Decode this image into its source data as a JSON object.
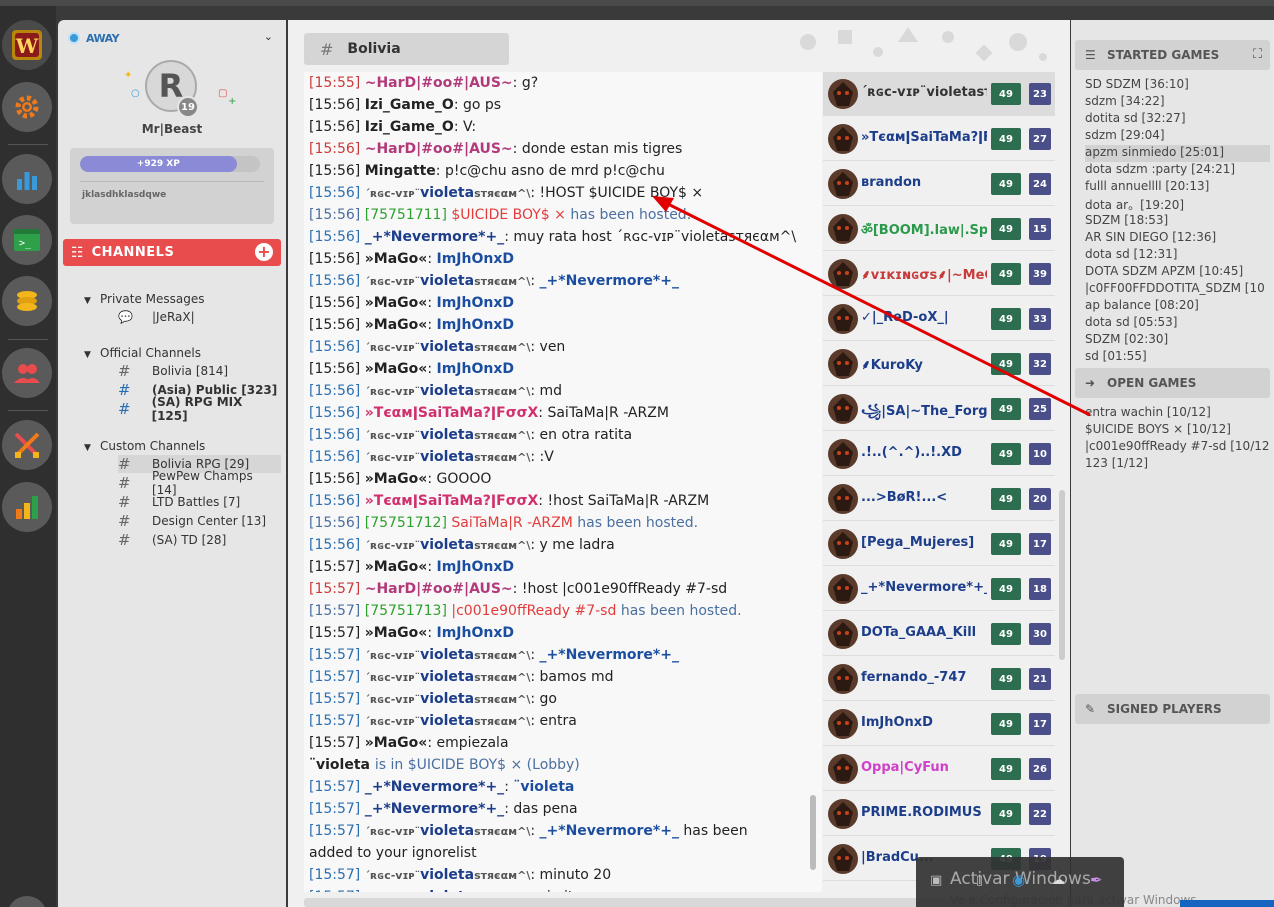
{
  "status": {
    "label": "AWAY"
  },
  "profile": {
    "name": "Mr|Beast",
    "level": "19",
    "xp_label": "+929 XP",
    "xp_fraction": 0.87,
    "motto": "jklasdhklasdqwe"
  },
  "channels": {
    "header": "CHANNELS",
    "groups": [
      {
        "title": "Private Messages",
        "items": [
          {
            "name": "|JeRaX|"
          }
        ]
      },
      {
        "title": "Official Channels",
        "items": [
          {
            "name": "Bolivia [814]"
          },
          {
            "name": "(Asia) Public [323]"
          },
          {
            "name": "(SA) RPG MIX [125]"
          }
        ]
      },
      {
        "title": "Custom Channels",
        "items": [
          {
            "name": "Bolivia RPG [29]"
          },
          {
            "name": "PewPew Champs [14]"
          },
          {
            "name": "LTD Battles [7]"
          },
          {
            "name": "Design Center [13]"
          },
          {
            "name": "(SA) TD [28]"
          }
        ]
      }
    ]
  },
  "tab": {
    "name": "Bolivia"
  },
  "messages": [
    {
      "ts": "[15:55]",
      "name": "~HarD|#oo#|AUS~",
      "text": "g?"
    },
    {
      "ts": "[15:56]",
      "name": "Izi_Game_O",
      "text": "go ps"
    },
    {
      "ts": "[15:56]",
      "name": "Izi_Game_O",
      "text": "V:"
    },
    {
      "ts": "[15:56]",
      "name": "~HarD|#oo#|AUS~",
      "text": "donde estan mis tigres"
    },
    {
      "ts": "[15:56]",
      "name": "Mingatte",
      "text": "p!c@chu asno de mrd p!c@chu"
    },
    {
      "ts": "[15:56]",
      "name": "´ʀɢᴄ-ᴠɪᴘ¨violetaѕтяєαм^\\",
      "text": "!HOST $UICIDE BOY$ ×"
    },
    {
      "ts": "[15:56]",
      "id": "[75751711]",
      "game": "$UICIDE BOY$ ×",
      "text": "has been hosted."
    },
    {
      "ts": "[15:56]",
      "name": "_+*Nevermore*+_",
      "text": "muy rata host ´ʀɢᴄ-ᴠɪᴘ¨violetaѕтяєαм^\\"
    },
    {
      "ts": "[15:56]",
      "name": "»MaGo«",
      "text": "ImJhOnxD"
    },
    {
      "ts": "[15:56]",
      "name": "´ʀɢᴄ-ᴠɪᴘ¨violetaѕтяєαм^\\",
      "text": "_+*Nevermore*+_"
    },
    {
      "ts": "[15:56]",
      "name": "»MaGo«",
      "text": "ImJhOnxD"
    },
    {
      "ts": "[15:56]",
      "name": "»MaGo«",
      "text": "ImJhOnxD"
    },
    {
      "ts": "[15:56]",
      "name": "´ʀɢᴄ-ᴠɪᴘ¨violetaѕтяєαм^\\",
      "text": "ven"
    },
    {
      "ts": "[15:56]",
      "name": "»MaGo«",
      "text": "ImJhOnxD"
    },
    {
      "ts": "[15:56]",
      "name": "´ʀɢᴄ-ᴠɪᴘ¨violetaѕтяєαм^\\",
      "text": "md"
    },
    {
      "ts": "[15:56]",
      "name": "»TєαмǀSaiTaMa?ǀFσσX",
      "text": "SaiTaMa|R -ARZM"
    },
    {
      "ts": "[15:56]",
      "name": "´ʀɢᴄ-ᴠɪᴘ¨violetaѕтяєαм^\\",
      "text": "en otra ratita"
    },
    {
      "ts": "[15:56]",
      "name": "´ʀɢᴄ-ᴠɪᴘ¨violetaѕтяєαм^\\",
      "text": ":V"
    },
    {
      "ts": "[15:56]",
      "name": "»MaGo«",
      "text": "GOOOO"
    },
    {
      "ts": "[15:56]",
      "name": "»TєαмǀSaiTaMa?ǀFσσX",
      "text": "!host SaiTaMa|R -ARZM"
    },
    {
      "ts": "[15:56]",
      "id": "[75751712]",
      "game": "SaiTaMa|R -ARZM",
      "text": "has been hosted."
    },
    {
      "ts": "[15:56]",
      "name": "´ʀɢᴄ-ᴠɪᴘ¨violetaѕтяєαм^\\",
      "text": "y me ladra"
    },
    {
      "ts": "[15:57]",
      "name": "»MaGo«",
      "text": "ImJhOnxD"
    },
    {
      "ts": "[15:57]",
      "name": "~HarD|#oo#|AUS~",
      "text": "!host |c001e90ffReady #7-sd"
    },
    {
      "ts": "[15:57]",
      "id": "[75751713]",
      "game": "|c001e90ffReady #7-sd",
      "text": "has been hosted."
    },
    {
      "ts": "[15:57]",
      "name": "»MaGo«",
      "text": "ImJhOnxD"
    },
    {
      "ts": "[15:57]",
      "name": "´ʀɢᴄ-ᴠɪᴘ¨violetaѕтяєαм^\\",
      "text": "_+*Nevermore*+_"
    },
    {
      "ts": "[15:57]",
      "name": "´ʀɢᴄ-ᴠɪᴘ¨violetaѕтяєαм^\\",
      "text": "bamos md"
    },
    {
      "ts": "[15:57]",
      "name": "´ʀɢᴄ-ᴠɪᴘ¨violetaѕтяєαм^\\",
      "text": "go"
    },
    {
      "ts": "[15:57]",
      "name": "´ʀɢᴄ-ᴠɪᴘ¨violetaѕтяєαм^\\",
      "text": "entra"
    },
    {
      "ts": "[15:57]",
      "name": "»MaGo«",
      "text": "empiezala"
    },
    {
      "lobby_name": "¨violeta",
      "text": "is in $UICIDE BOY$ × (Lobby)"
    },
    {
      "ts": "[15:57]",
      "name": "_+*Nevermore*+_",
      "text": "¨violeta"
    },
    {
      "ts": "[15:57]",
      "name": "_+*Nevermore*+_",
      "text": "das pena"
    },
    {
      "ts": "[15:57]",
      "name": "´ʀɢᴄ-ᴠɪᴘ¨violetaѕтяєαм^\\",
      "text": "_+*Nevermore*+_",
      "suffix": "has been"
    },
    {
      "cont": "added to your ignorelist"
    },
    {
      "ts": "[15:57]",
      "name": "´ʀɢᴄ-ᴠɪᴘ¨violetaѕтяєαм^\\",
      "text": "minuto 20"
    },
    {
      "ts": "[15:57]",
      "name": "´ʀɢᴄ-ᴠɪᴘ¨violetaѕтяєαм^\\",
      "text": "sin items"
    }
  ],
  "users": [
    {
      "name": "´ʀɢᴄ-ᴠɪᴘ¨violetaѕтяєα",
      "level": "49",
      "count": "23"
    },
    {
      "name": "»TєαмǀSaiTaMa?ǀFσ",
      "level": "49",
      "count": "27"
    },
    {
      "name": "ʙrandon",
      "level": "49",
      "count": "24"
    },
    {
      "name": "ॐ[BOOM].law|.Sport",
      "level": "49",
      "count": "15"
    },
    {
      "name": "⸙ᴠɪᴋɪɴɢσѕ⸙|~MeG@",
      "level": "49",
      "count": "39"
    },
    {
      "name": "✓|_ReD-oX_|",
      "level": "49",
      "count": "33"
    },
    {
      "name": "⸙KuroKy",
      "level": "49",
      "count": "32"
    },
    {
      "name": "꧁|SA|~The_Forgo",
      "level": "49",
      "count": "25"
    },
    {
      "name": ".!..(^.^)..!.XD",
      "level": "49",
      "count": "10"
    },
    {
      "name": "...>BøR!...<",
      "level": "49",
      "count": "20"
    },
    {
      "name": "[Pega_Mujeres]",
      "level": "49",
      "count": "17"
    },
    {
      "name": "_+*Nevermore*+_",
      "level": "49",
      "count": "18"
    },
    {
      "name": "DOTa_GAAA_Kill",
      "level": "49",
      "count": "30"
    },
    {
      "name": "fernando_-747",
      "level": "49",
      "count": "21"
    },
    {
      "name": "ImJhOnxD",
      "level": "49",
      "count": "17"
    },
    {
      "name": "Oppa|CyFun",
      "level": "49",
      "count": "26"
    },
    {
      "name": "PRIME.RODIMUS",
      "level": "49",
      "count": "22"
    },
    {
      "name": "|BradCu...",
      "level": "49",
      "count": "19"
    }
  ],
  "right": {
    "started_title": "STARTED GAMES",
    "started": [
      "SD SDZM [36:10]",
      "sdzm [34:22]",
      "dotita sd [32:27]",
      "sdzm [29:04]",
      "apzm sinmiedo [25:01]",
      "dota sdzm :party [24:21]",
      "fulll annuellll [20:13]",
      "dota ar。[19:20]",
      "SDZM [18:53]",
      "AR SIN DIEGO [12:36]",
      "dota sd [12:31]",
      "DOTA SDZM APZM [10:45]",
      "|c0FF00FFDDOTITA_SDZM [10",
      "ap balance [08:20]",
      "dota sd [05:53]",
      "SDZM [02:30]",
      "sd [01:55]"
    ],
    "open_title": "OPEN GAMES",
    "open": [
      "entra wachin [10/12]",
      "$UICIDE BOYS × [10/12]",
      "|c001e90ffReady #7-sd [10/12",
      "123 [1/12]"
    ],
    "signed_title": "SIGNED PLAYERS"
  },
  "overlay": {
    "activate": "Activar Windows",
    "sub": "Ve a Configuración para activar Windows."
  }
}
